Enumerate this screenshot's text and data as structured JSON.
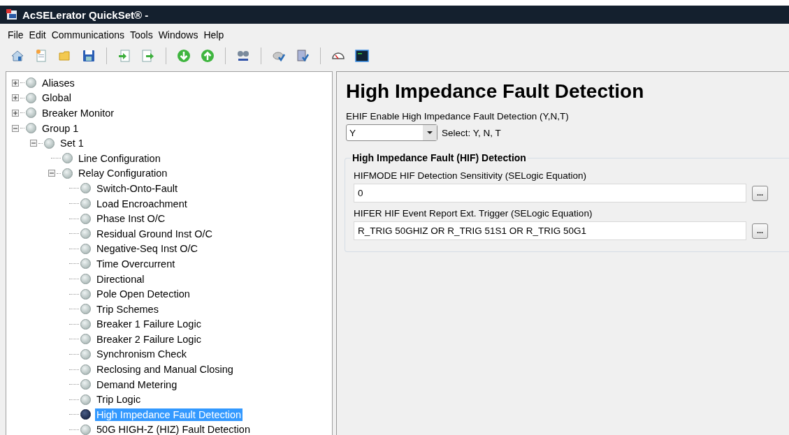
{
  "window": {
    "title": "AcSELerator QuickSet® -"
  },
  "menu": [
    "File",
    "Edit",
    "Communications",
    "Tools",
    "Windows",
    "Help"
  ],
  "toolbar": [
    {
      "buttons": [
        {
          "kind": "home"
        },
        {
          "kind": "new"
        },
        {
          "kind": "open"
        },
        {
          "kind": "save"
        }
      ]
    },
    {
      "buttons": [
        {
          "kind": "import"
        },
        {
          "kind": "export"
        }
      ]
    },
    {
      "buttons": [
        {
          "kind": "download"
        },
        {
          "kind": "upload"
        }
      ]
    },
    {
      "buttons": [
        {
          "kind": "find"
        }
      ]
    },
    {
      "buttons": [
        {
          "kind": "check-disk"
        },
        {
          "kind": "check-settings"
        }
      ]
    },
    {
      "buttons": [
        {
          "kind": "gauge"
        },
        {
          "kind": "terminal"
        }
      ]
    }
  ],
  "tree": [
    {
      "label": "Aliases",
      "expanded": false,
      "selected": false
    },
    {
      "label": "Global",
      "expanded": false,
      "selected": false
    },
    {
      "label": "Breaker Monitor",
      "expanded": false,
      "selected": false
    },
    {
      "label": "Group 1",
      "expanded": true,
      "selected": false,
      "children": [
        {
          "label": "Set 1",
          "expanded": true,
          "selected": false,
          "children": [
            {
              "label": "Line Configuration",
              "selected": false
            },
            {
              "label": "Relay Configuration",
              "expanded": true,
              "selected": false,
              "children": [
                {
                  "label": "Switch-Onto-Fault",
                  "selected": false
                },
                {
                  "label": "Load Encroachment",
                  "selected": false
                },
                {
                  "label": "Phase Inst O/C",
                  "selected": false
                },
                {
                  "label": "Residual Ground Inst O/C",
                  "selected": false
                },
                {
                  "label": "Negative-Seq Inst O/C",
                  "selected": false
                },
                {
                  "label": "Time Overcurrent",
                  "selected": false
                },
                {
                  "label": "Directional",
                  "selected": false
                },
                {
                  "label": "Pole Open Detection",
                  "selected": false
                },
                {
                  "label": "Trip Schemes",
                  "selected": false
                },
                {
                  "label": "Breaker 1 Failure Logic",
                  "selected": false
                },
                {
                  "label": "Breaker 2 Failure Logic",
                  "selected": false
                },
                {
                  "label": "Synchronism Check",
                  "selected": false
                },
                {
                  "label": "Reclosing and Manual Closing",
                  "selected": false
                },
                {
                  "label": "Demand Metering",
                  "selected": false
                },
                {
                  "label": "Trip Logic",
                  "selected": false
                },
                {
                  "label": "High Impedance Fault Detection",
                  "selected": true
                },
                {
                  "label": "50G HIGH-Z (HIZ) Fault Detection",
                  "selected": false
                }
              ]
            }
          ]
        }
      ]
    }
  ],
  "page": {
    "heading": "High Impedance Fault Detection",
    "enable": {
      "label": "EHIF Enable High Impedance Fault Detection (Y,N,T)",
      "value": "Y",
      "hint": "Select: Y, N, T"
    },
    "group": {
      "title": "High Impedance Fault (HIF) Detection",
      "fields": [
        {
          "label": "HIFMODE HIF Detection Sensitivity (SELogic Equation)",
          "value": "0",
          "button": "..."
        },
        {
          "label": "HIFER HIF Event Report Ext. Trigger (SELogic Equation)",
          "value": "R_TRIG 50GHIZ OR R_TRIG 51S1 OR R_TRIG 50G1",
          "button": "..."
        }
      ]
    }
  }
}
